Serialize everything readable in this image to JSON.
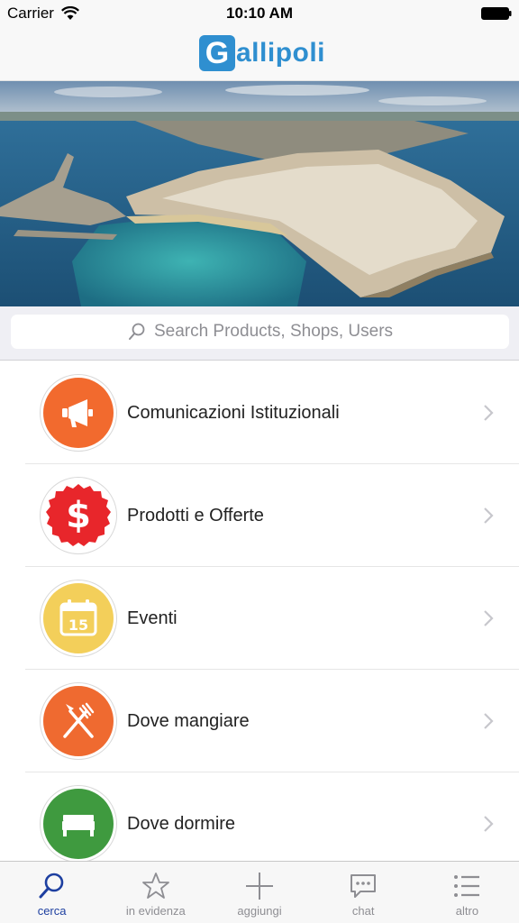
{
  "status_bar": {
    "carrier": "Carrier",
    "time": "10:10 AM"
  },
  "header": {
    "logo_letter": "G",
    "logo_rest": "allipoli"
  },
  "search": {
    "placeholder": "Search Products, Shops, Users"
  },
  "list": {
    "items": [
      {
        "label": "Comunicazioni Istituzionali",
        "icon": "megaphone-icon",
        "color": "#f26a2e"
      },
      {
        "label": "Prodotti e Offerte",
        "icon": "dollar-badge-icon",
        "color": "#e8262b"
      },
      {
        "label": "Eventi",
        "icon": "calendar-icon",
        "color": "#f3cf5a"
      },
      {
        "label": "Dove mangiare",
        "icon": "fork-knife-icon",
        "color": "#ef6a30"
      },
      {
        "label": "Dove dormire",
        "icon": "bed-icon",
        "color": "#3f9a3f"
      }
    ]
  },
  "calendar_day": "15",
  "tabbar": {
    "tabs": [
      {
        "label": "cerca",
        "icon": "search-icon",
        "active": true
      },
      {
        "label": "in evidenza",
        "icon": "star-icon",
        "active": false
      },
      {
        "label": "aggiungi",
        "icon": "plus-icon",
        "active": false
      },
      {
        "label": "chat",
        "icon": "chat-bubble-icon",
        "active": false
      },
      {
        "label": "altro",
        "icon": "list-icon",
        "active": false
      }
    ]
  },
  "colors": {
    "brand": "#2f8fd0",
    "active_tab": "#1d3fa0",
    "inactive_tab": "#8e8e93"
  }
}
